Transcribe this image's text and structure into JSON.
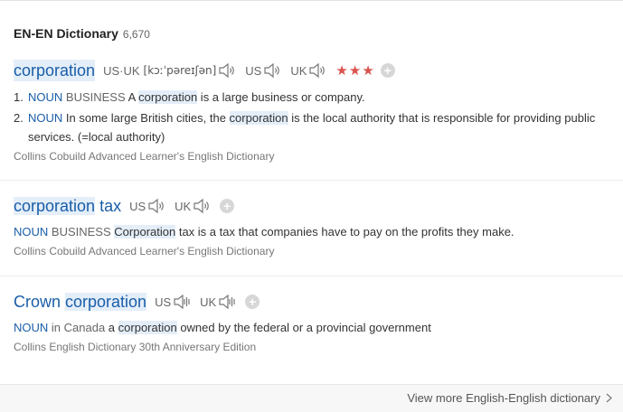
{
  "section": {
    "title": "EN-EN Dictionary",
    "count": "6,670"
  },
  "entries": {
    "e1": {
      "headword_hl": "corporation",
      "pron_us_uk_label": "US·UK",
      "ipa": "[kɔːˈpəreɪʃən]",
      "us_label": "US",
      "uk_label": "UK",
      "stars": "★★★",
      "plus": "+",
      "senses": [
        {
          "num": "1.",
          "pos": "NOUN",
          "tag": "BUSINESS",
          "pre": "A ",
          "hl": "corporation",
          "post": " is a large business or company."
        },
        {
          "num": "2.",
          "pos": "NOUN",
          "pre": "In some large British cities, the ",
          "hl": "corporation",
          "post": " is the local authority that is responsible for providing public services. (=local authority)"
        }
      ],
      "source": "Collins Cobuild Advanced Learner's English Dictionary"
    },
    "e2": {
      "headword_hl": "corporation",
      "headword_rest": " tax",
      "us_label": "US",
      "uk_label": "UK",
      "plus": "+",
      "pos": "NOUN",
      "tag": "BUSINESS",
      "hl": "Corporation",
      "post": " tax is a tax that companies have to pay on the profits they make.",
      "source": "Collins Cobuild Advanced Learner's English Dictionary"
    },
    "e3": {
      "headword_pre": "Crown ",
      "headword_hl": "corporation",
      "us_label": "US",
      "uk_label": "UK",
      "plus": "+",
      "pos": "NOUN",
      "tag": "in Canada",
      "pre": " a ",
      "hl": "corporation",
      "post": " owned by the federal or a provincial government",
      "source": "Collins English Dictionary 30th Anniversary Edition"
    }
  },
  "footer": {
    "link": "View more English-English dictionary"
  },
  "colors": {
    "link": "#1a5ea8",
    "highlight": "#e4eef9",
    "stars": "#d9534f"
  },
  "icons": {
    "speaker": "speaker-icon",
    "plus": "plus-icon",
    "chevron": "chevron-right-icon"
  }
}
